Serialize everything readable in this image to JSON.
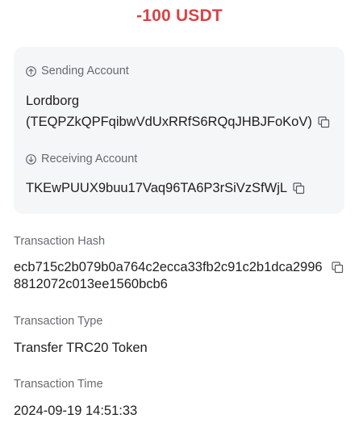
{
  "amount": "-100 USDT",
  "accounts": {
    "sending": {
      "label": "Sending Account",
      "name": "Lordborg",
      "address": "(TEQPZkQPFqibwVdUxRRfS6RQqJHBJFoKoV)"
    },
    "receiving": {
      "label": "Receiving Account",
      "address": "TKEwPUUX9buu17Vaq96TA6P3rSiVzSfWjL"
    }
  },
  "details": {
    "hash_label": "Transaction Hash",
    "hash_value": "ecb715c2b079b0a764c2ecca33fb2c91c2b1dca29968812072c013ee1560bcb6",
    "type_label": "Transaction Type",
    "type_value": "Transfer TRC20 Token",
    "time_label": "Transaction Time",
    "time_value": "2024-09-19 14:51:33"
  },
  "icons": {
    "sending": "arrow-up-circle-icon",
    "receiving": "arrow-down-circle-icon",
    "copy": "copy-icon"
  },
  "colors": {
    "amount": "#d64545",
    "card_bg": "#f5f6f8",
    "label": "#666a70",
    "text": "#1f1f1f"
  }
}
